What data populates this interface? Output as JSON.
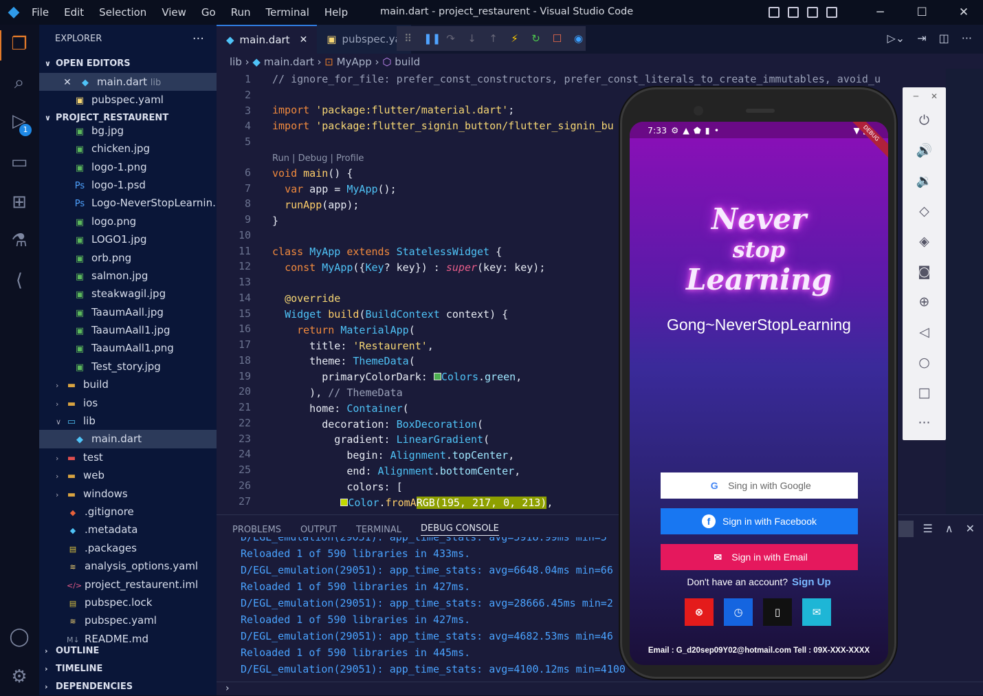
{
  "window": {
    "title": "main.dart - project_restaurent - Visual Studio Code"
  },
  "menu": [
    "File",
    "Edit",
    "Selection",
    "View",
    "Go",
    "Run",
    "Terminal",
    "Help"
  ],
  "activity": {
    "badge": "1"
  },
  "explorer": {
    "header": "EXPLORER",
    "open_editors_label": "OPEN EDITORS",
    "open_editors": [
      {
        "name": "main.dart",
        "hint": "lib"
      },
      {
        "name": "pubspec.yaml",
        "hint": ""
      }
    ],
    "project_label": "PROJECT_RESTAURENT",
    "files": [
      {
        "name": "bg.jpg",
        "icon": "image-icon"
      },
      {
        "name": "chicken.jpg",
        "icon": "image-icon"
      },
      {
        "name": "logo-1.png",
        "icon": "image-icon"
      },
      {
        "name": "logo-1.psd",
        "icon": "psd-icon"
      },
      {
        "name": "Logo-NeverStopLearnin...",
        "icon": "psd-icon"
      },
      {
        "name": "logo.png",
        "icon": "image-icon"
      },
      {
        "name": "LOGO1.jpg",
        "icon": "image-icon"
      },
      {
        "name": "orb.png",
        "icon": "image-icon"
      },
      {
        "name": "salmon.jpg",
        "icon": "image-icon"
      },
      {
        "name": "steakwagil.jpg",
        "icon": "image-icon"
      },
      {
        "name": "TaaumAall.jpg",
        "icon": "image-icon"
      },
      {
        "name": "TaaumAall1.jpg",
        "icon": "image-icon"
      },
      {
        "name": "TaaumAall1.png",
        "icon": "image-icon"
      },
      {
        "name": "Test_story.jpg",
        "icon": "image-icon"
      }
    ],
    "folders": [
      {
        "name": "build",
        "icon": "folder-icon"
      },
      {
        "name": "ios",
        "icon": "folder-icon"
      },
      {
        "name": "lib",
        "icon": "folder-open-icon"
      },
      {
        "name": "main.dart",
        "icon": "dart-icon"
      },
      {
        "name": "test",
        "icon": "folder-test-icon"
      },
      {
        "name": "web",
        "icon": "folder-icon"
      },
      {
        "name": "windows",
        "icon": "folder-icon"
      }
    ],
    "root_files": [
      {
        "name": ".gitignore",
        "icon": "git-icon"
      },
      {
        "name": ".metadata",
        "icon": "dart-icon"
      },
      {
        "name": ".packages",
        "icon": "file-icon"
      },
      {
        "name": "analysis_options.yaml",
        "icon": "yaml-icon"
      },
      {
        "name": "project_restaurent.iml",
        "icon": "code-icon"
      },
      {
        "name": "pubspec.lock",
        "icon": "lock-icon"
      },
      {
        "name": "pubspec.yaml",
        "icon": "yaml-icon"
      },
      {
        "name": "README.md",
        "icon": "markdown-icon"
      }
    ],
    "sections": [
      "OUTLINE",
      "TIMELINE",
      "DEPENDENCIES"
    ]
  },
  "editor": {
    "tabs": [
      "main.dart",
      "pubspec.ya"
    ],
    "breadcrumb": [
      "lib",
      "main.dart",
      "MyApp",
      "build"
    ],
    "codelens": "Run | Debug | Profile",
    "line_numbers": [
      "1",
      "2",
      "3",
      "4",
      "5",
      "6",
      "7",
      "8",
      "9",
      "10",
      "11",
      "12",
      "13",
      "14",
      "15",
      "16",
      "17",
      "18",
      "19",
      "20",
      "21",
      "22",
      "23",
      "24",
      "25",
      "26",
      "27"
    ]
  },
  "panel": {
    "tabs": [
      "PROBLEMS",
      "OUTPUT",
      "TERMINAL",
      "DEBUG CONSOLE"
    ],
    "lines": [
      "D/EGL_emulation(29051): app_time_stats: avg=5918.99ms min=5",
      "Reloaded 1 of 590 libraries in 433ms.",
      "D/EGL_emulation(29051): app_time_stats: avg=6648.04ms min=66",
      "Reloaded 1 of 590 libraries in 427ms.",
      "D/EGL_emulation(29051): app_time_stats: avg=28666.45ms min=2",
      "Reloaded 1 of 590 libraries in 427ms.",
      "D/EGL_emulation(29051): app_time_stats: avg=4682.53ms min=46",
      "Reloaded 1 of 590 libraries in 445ms.",
      "D/EGL_emulation(29051): app_time_stats: avg=4100.12ms min=4100"
    ]
  },
  "phone": {
    "time": "7:33",
    "debug_banner": "DEBUG",
    "logo_lines": [
      "Never",
      "stop",
      "Learning"
    ],
    "app_title": "Gong~NeverStopLearning",
    "google_btn": "Sing in  with Google",
    "facebook_btn": "Sign in  with Facebook",
    "email_btn": "Sign in  with Email",
    "no_account": "Don't have an account?",
    "sign_up": "Sign Up",
    "footer": "Email : G_d20sep09Y02@hotmail.com Tell : 09X-XXX-XXXX",
    "colors": {
      "google_g": "#4285f4",
      "facebook": "#1877f2",
      "email": "#e5185d",
      "red": "#e41b1b",
      "blue": "#1565e0",
      "teal": "#1eb6d6"
    }
  }
}
